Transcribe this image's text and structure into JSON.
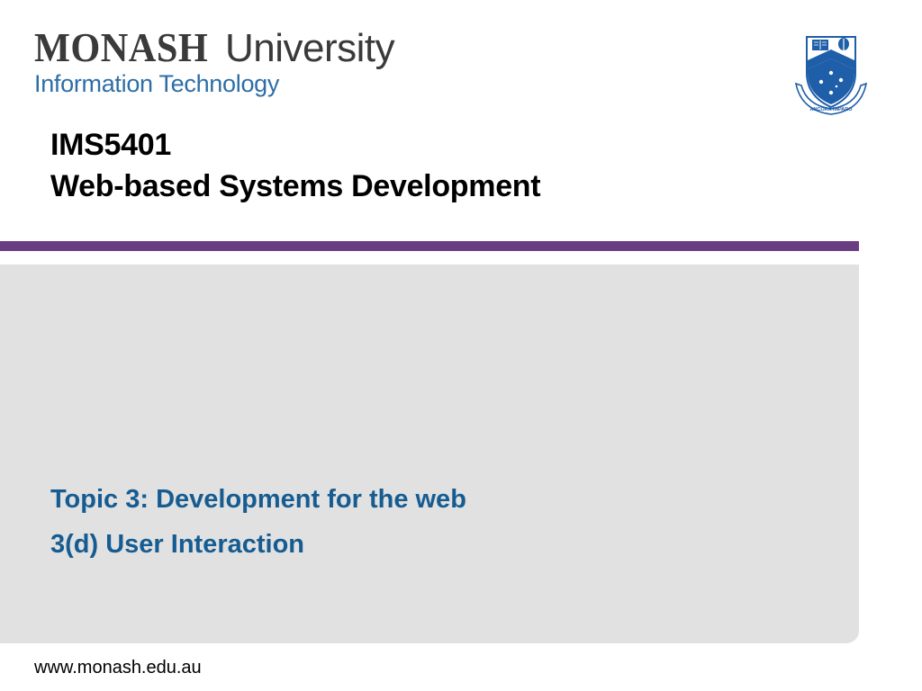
{
  "header": {
    "logo_bold": "MONASH",
    "logo_light": "University",
    "logo_sub": "Information Technology",
    "crest_icon": "monash-crest-icon",
    "crest_motto": "ANCORA IMPARO"
  },
  "title": {
    "line1": "IMS5401",
    "line2": "Web-based Systems Development"
  },
  "subtitle": {
    "line1": "Topic 3: Development for the web",
    "line2": "3(d) User Interaction"
  },
  "footer": {
    "url": "www.monash.edu.au"
  },
  "colors": {
    "accent_rule": "#6a3d82",
    "panel_bg": "#e1e1e1",
    "subtitle_text": "#165c91",
    "logo_sub_text": "#2d6ea6",
    "crest_blue": "#1f5ea8"
  }
}
